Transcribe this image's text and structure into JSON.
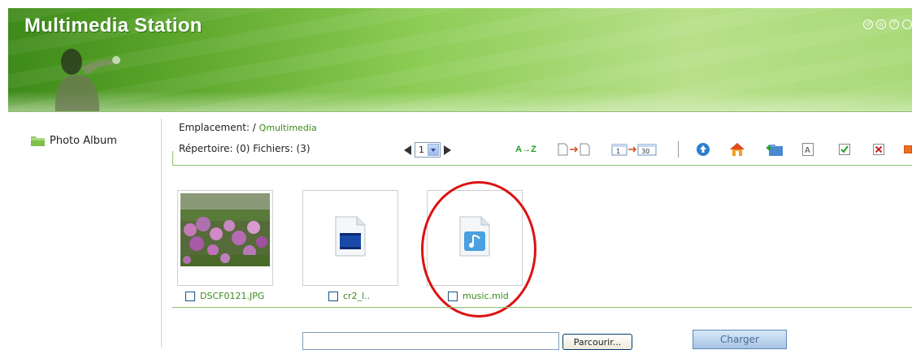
{
  "header": {
    "title": "Multimedia Station",
    "window_icons": [
      "back-icon",
      "home-icon",
      "help-icon",
      "more-icon"
    ]
  },
  "sidebar": {
    "items": [
      {
        "label": "Photo Album",
        "icon": "folder-icon"
      }
    ]
  },
  "location": {
    "label": "Emplacement: /",
    "path": "Qmultimedia"
  },
  "directory_info": "Répertoire: (0) Fichiers: (3)",
  "pager": {
    "current_page": "1"
  },
  "toolbar": {
    "sort_label": "A→Z",
    "icons": [
      "sort-name-icon",
      "sort-type-icon",
      "sort-date-icon",
      "up-folder-icon",
      "home-icon",
      "new-folder-icon",
      "rename-icon",
      "select-all-icon",
      "delete-icon",
      "close-icon"
    ]
  },
  "files": [
    {
      "name": "DSCF0121.JPG",
      "type": "photo"
    },
    {
      "name": "cr2_l..",
      "type": "video"
    },
    {
      "name": "music.mid",
      "type": "audio"
    }
  ],
  "upload": {
    "input_value": "",
    "browse_label": "Parcourir...",
    "submit_label": "Charger"
  },
  "colors": {
    "accent_green": "#3a8a1a",
    "highlight": "#dd1111"
  }
}
